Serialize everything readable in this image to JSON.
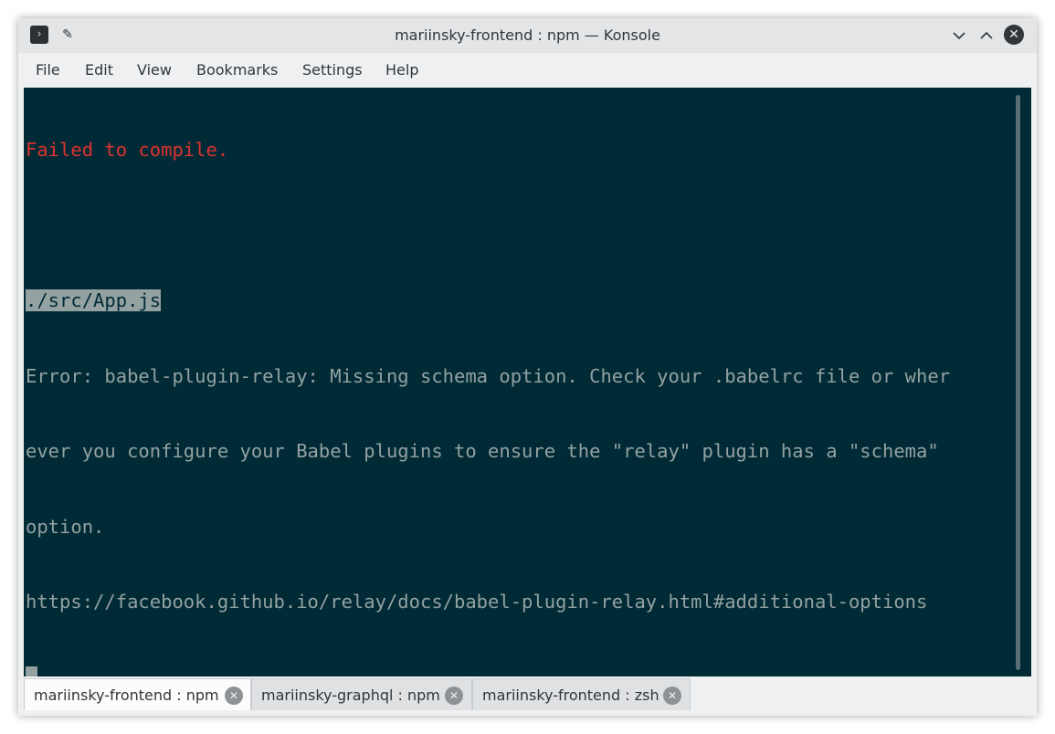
{
  "window": {
    "title": "mariinsky-frontend : npm — Konsole"
  },
  "titlebar": {
    "app_icon": "terminal-icon",
    "pin_icon": "pin-icon",
    "minimize_icon": "chevron-down-icon",
    "maximize_icon": "chevron-up-icon",
    "close_icon": "close-icon"
  },
  "menu": {
    "items": [
      "File",
      "Edit",
      "View",
      "Bookmarks",
      "Settings",
      "Help"
    ]
  },
  "terminal": {
    "lines": [
      "Failed to compile.",
      "",
      "./src/App.js",
      "Error: babel-plugin-relay: Missing schema option. Check your .babelrc file or wher",
      "ever you configure your Babel plugins to ensure the \"relay\" plugin has a \"schema\"",
      "option.",
      "https://facebook.github.io/relay/docs/babel-plugin-relay.html#additional-options"
    ],
    "colors": {
      "background": "#002b36",
      "foreground": "#93a1a1",
      "error": "#dc322f"
    }
  },
  "tabs": [
    {
      "label": "mariinsky-frontend : npm",
      "active": true
    },
    {
      "label": "mariinsky-graphql : npm",
      "active": false
    },
    {
      "label": "mariinsky-frontend : zsh",
      "active": false
    }
  ]
}
